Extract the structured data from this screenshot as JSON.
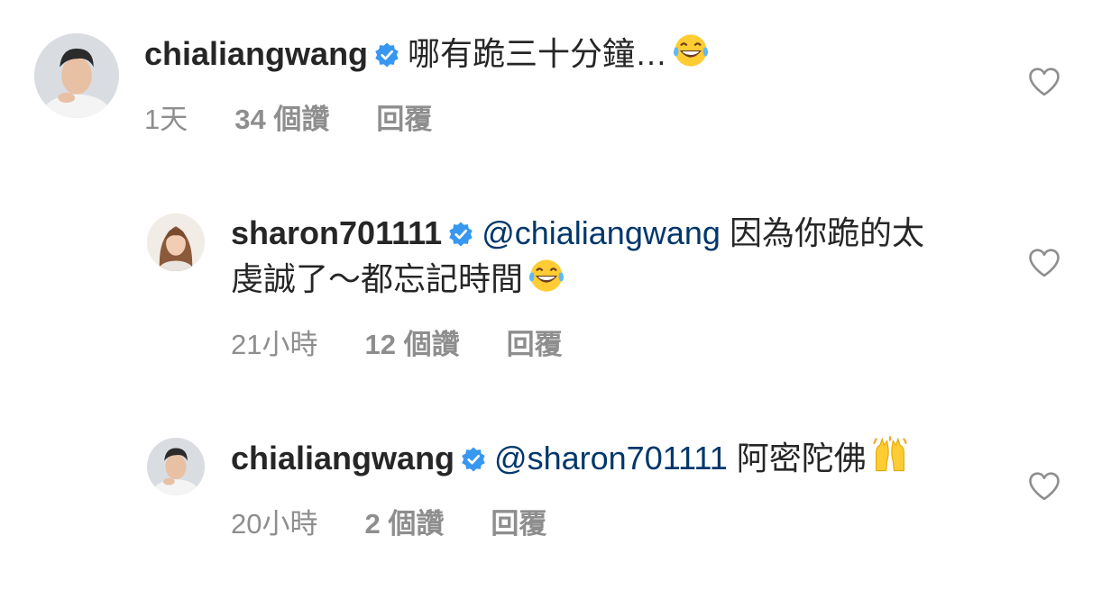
{
  "comments": [
    {
      "username": "chialiangwang",
      "mention": "",
      "text": "哪有跪三十分鐘…",
      "emoji": "tears-of-joy",
      "time": "1天",
      "likes": "34 個讚",
      "reply": "回覆"
    },
    {
      "username": "sharon701111",
      "mention": "@chialiangwang",
      "text": "因為你跪的太虔誠了～都忘記時間",
      "emoji": "tears-of-joy",
      "time": "21小時",
      "likes": "12 個讚",
      "reply": "回覆"
    },
    {
      "username": "chialiangwang",
      "mention": "@sharon701111",
      "text": "阿密陀佛",
      "emoji": "raising-hands",
      "time": "20小時",
      "likes": "2 個讚",
      "reply": "回覆"
    }
  ],
  "colors": {
    "text": "#262626",
    "meta": "#8e8e8e",
    "mention": "#00376b",
    "verified": "#3897f0",
    "heart": "#8e8e8e"
  }
}
